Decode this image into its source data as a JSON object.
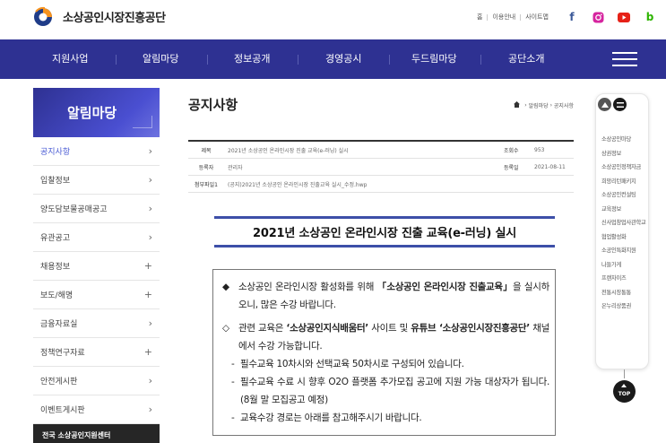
{
  "header": {
    "org_name": "소상공인시장진흥공단",
    "util_links": [
      "홈",
      "이용안내",
      "사이트맵"
    ],
    "sns": [
      {
        "name": "facebook",
        "glyph": "f",
        "color": "#3b5998"
      },
      {
        "name": "instagram",
        "glyph": "◎",
        "color": "#d6249f"
      },
      {
        "name": "youtube",
        "glyph": "▶",
        "color": "#e62117"
      },
      {
        "name": "blog",
        "glyph": "b",
        "color": "#2db400"
      }
    ]
  },
  "gnb": {
    "items": [
      "지원사업",
      "알림마당",
      "정보공개",
      "경영공시",
      "두드림마당",
      "공단소개"
    ]
  },
  "lnb": {
    "title": "알림마당",
    "items": [
      {
        "label": "공지사항",
        "mark": "›",
        "active": true
      },
      {
        "label": "입찰정보",
        "mark": "›"
      },
      {
        "label": "양도담보물공매공고",
        "mark": "›"
      },
      {
        "label": "유관공고",
        "mark": "›"
      },
      {
        "label": "채용정보",
        "mark": "+"
      },
      {
        "label": "보도/해명",
        "mark": "+"
      },
      {
        "label": "금융자료실",
        "mark": "›"
      },
      {
        "label": "정책연구자료",
        "mark": "+"
      },
      {
        "label": "안전게시판",
        "mark": "›"
      },
      {
        "label": "이벤트게시판",
        "mark": "›"
      }
    ],
    "bottom_label": "전국 소상공인지원센터"
  },
  "content": {
    "page_title": "공지사항",
    "breadcrumb": [
      "알림마당",
      "공지사항"
    ],
    "meta": {
      "title_label": "제목",
      "title_value": "2021년 소상공인 온라인시장 진출 교육(e-러닝) 실시",
      "views_label": "조회수",
      "views_value": "953",
      "author_label": "등록자",
      "author_value": "관리자",
      "date_label": "등록일",
      "date_value": "2021-08-11",
      "attach_label": "첨부파일1",
      "attach_value": "(공지)2021년 소상공인 온라인시장 진출교육 실시_수정.hwp"
    },
    "notice_title": "2021년 소상공인 온라인시장 진출 교육(e-러닝) 실시",
    "body": {
      "p1_bullet": "◆",
      "p1_a": "소상공인 온라인시장 활성화를 위해 ",
      "p1_b": "「소상공인 온라인시장 진출교육」",
      "p1_c": "을 실시하오니, 많은 수강 바랍니다.",
      "p2_bullet": "◇",
      "p2_a": "관련 교육은 ",
      "p2_b": "‘소상공인지식배움터’",
      "p2_c": " 사이트 및 ",
      "p2_d": "유튜브 ‘소상공인시장진흥공단’",
      "p2_e": " 채널에서 수강 가능합니다.",
      "sub_bullet": "-",
      "sub1": "필수교육 10차시와 선택교육 50차시로 구성되어 있습니다.",
      "sub2": "필수교육 수료 시 향후 O2O 플랫폼 추가모집 공고에 지원 가능 대상자가 됩니다.(8월 말 모집공고 예정)",
      "sub3": "교육수강 경로는 아래를 참고해주시기 바랍니다."
    }
  },
  "quick": {
    "items": [
      "소상공인마당",
      "상권정보",
      "소상공인정책자금",
      "희망리턴패키지",
      "소상공인컨설팅",
      "교육정보",
      "신사업창업사관학교",
      "협업활성화",
      "소공인특화지원",
      "나들가게",
      "프랜차이즈",
      "전통시장통통",
      "온누리상품권"
    ],
    "top_label": "TOP"
  },
  "colors": {
    "brand_navy": "#2e3192",
    "accent_blue": "#4a5bd4",
    "logo_orange": "#f7931e",
    "logo_blue": "#1f3c88"
  }
}
